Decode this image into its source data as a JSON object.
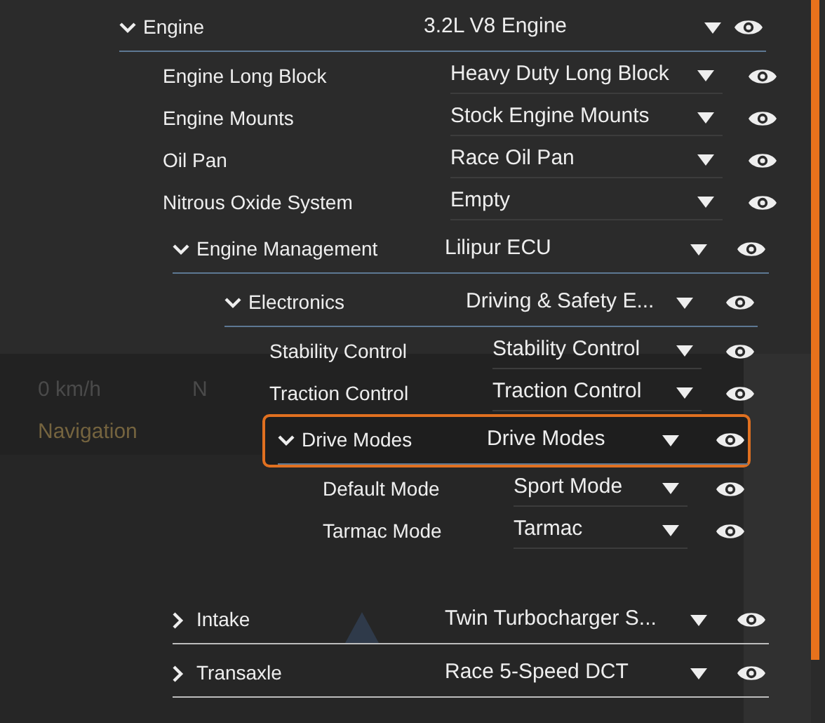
{
  "hud": {
    "speed": "0 km/h",
    "gear": "N",
    "navigation": "Navigation"
  },
  "tree": [
    {
      "kind": "group",
      "label": "Engine",
      "value": "3.2L V8 Engine",
      "expanded": true,
      "selected": false,
      "children": [
        {
          "kind": "part",
          "label": "Engine Long Block",
          "value": "Heavy Duty Long Block",
          "selected": false
        },
        {
          "kind": "part",
          "label": "Engine Mounts",
          "value": "Stock Engine Mounts",
          "selected": false
        },
        {
          "kind": "part",
          "label": "Oil Pan",
          "value": "Race Oil Pan",
          "selected": false
        },
        {
          "kind": "part",
          "label": "Nitrous Oxide System",
          "value": "Empty",
          "selected": false
        },
        {
          "kind": "group",
          "label": "Engine Management",
          "value": "Lilipur ECU",
          "expanded": true,
          "selected": false,
          "children": [
            {
              "kind": "group",
              "label": "Electronics",
              "value": "Driving & Safety E...",
              "expanded": true,
              "selected": false,
              "children": [
                {
                  "kind": "part",
                  "label": "Stability Control",
                  "value": "Stability Control",
                  "selected": false
                },
                {
                  "kind": "part",
                  "label": "Traction Control",
                  "value": "Traction Control",
                  "selected": false
                },
                {
                  "kind": "group",
                  "label": "Drive Modes",
                  "value": "Drive Modes",
                  "expanded": true,
                  "selected": true,
                  "children": [
                    {
                      "kind": "part",
                      "label": "Default Mode",
                      "value": "Sport Mode",
                      "selected": false
                    },
                    {
                      "kind": "part",
                      "label": "Tarmac Mode",
                      "value": "Tarmac",
                      "selected": false
                    }
                  ]
                }
              ]
            }
          ]
        },
        {
          "kind": "group",
          "label": "Intake",
          "value": "Twin Turbocharger S...",
          "expanded": false,
          "selected": false
        },
        {
          "kind": "group",
          "label": "Transaxle",
          "value": "Race 5-Speed DCT",
          "expanded": false,
          "selected": false
        }
      ]
    }
  ]
}
